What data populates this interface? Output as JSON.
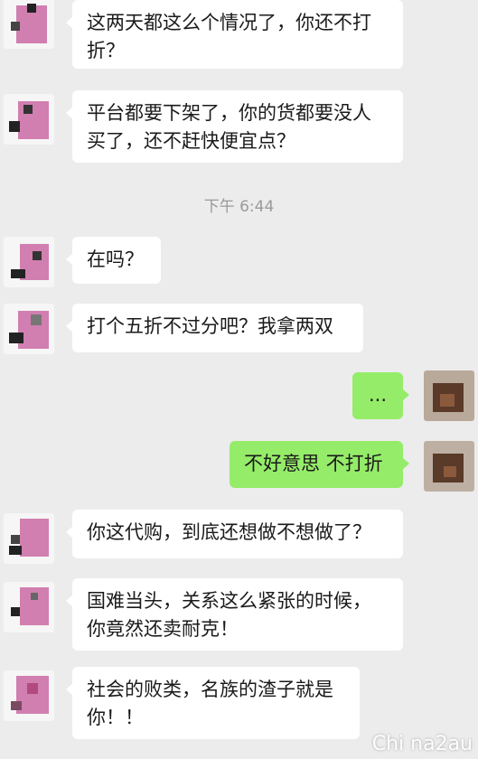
{
  "messages": [
    {
      "side": "left",
      "text": "这两天都这么个情况了，你还不打折？"
    },
    {
      "side": "left",
      "text": "平台都要下架了，你的货都要没人买了，还不赶快便宜点？"
    },
    {
      "side": "left",
      "text": "在吗？"
    },
    {
      "side": "left",
      "text": "打个五折不过分吧？我拿两双"
    },
    {
      "side": "right",
      "text": "..."
    },
    {
      "side": "right",
      "text": "不好意思 不打折"
    },
    {
      "side": "left",
      "text": "你这代购，到底还想做不想做了？"
    },
    {
      "side": "left",
      "text": "国难当头，关系这么紧张的时候，你竟然还卖耐克！"
    },
    {
      "side": "left",
      "text": "社会的败类，名族的渣子就是你！！"
    }
  ],
  "timestamp": "下午 6:44",
  "watermark": "Chi na2au",
  "colors": {
    "background": "#ececec",
    "bubble_in": "#ffffff",
    "bubble_out": "#95ec69",
    "avatar_pink": "#d17fb0"
  }
}
